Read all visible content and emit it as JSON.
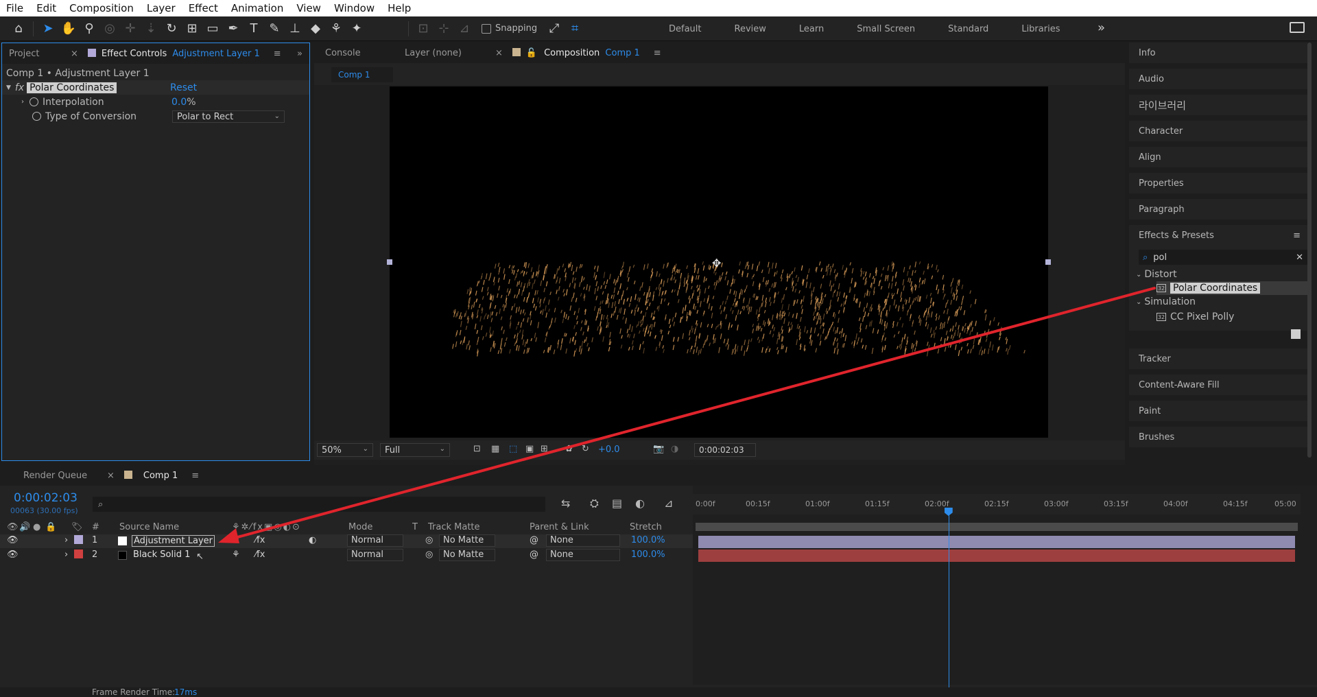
{
  "menu": [
    "File",
    "Edit",
    "Composition",
    "Layer",
    "Effect",
    "Animation",
    "View",
    "Window",
    "Help"
  ],
  "toolbar": {
    "snapping_label": "Snapping",
    "workspaces": [
      "Default",
      "Review",
      "Learn",
      "Small Screen",
      "Standard",
      "Libraries"
    ],
    "more_label": "»"
  },
  "left_panel": {
    "tabs": {
      "project": "Project",
      "close": "×",
      "effect_controls": "Effect Controls",
      "layer_ref": "Adjustment Layer 1",
      "menu": "≡",
      "expand": "»"
    },
    "breadcrumb": "Comp 1 • Adjustment Layer 1",
    "effect": {
      "fx_label": "fx",
      "name": "Polar Coordinates",
      "reset": "Reset",
      "interpolation_label": "Interpolation",
      "interpolation_value": "0.0",
      "interpolation_unit": "%",
      "conversion_label": "Type of Conversion",
      "conversion_value": "Polar to Rect"
    }
  },
  "comp_panel": {
    "tabs": {
      "console": "Console",
      "layer": "Layer (none)",
      "close": "×",
      "composition": "Composition",
      "comp_ref": "Comp 1",
      "menu": "≡"
    },
    "subtab": "Comp 1",
    "footer": {
      "zoom": "50%",
      "resolution": "Full",
      "exposure": "+0.0",
      "timecode": "0:00:02:03"
    }
  },
  "right_panel": {
    "items_top": [
      "Info",
      "Audio",
      "라이브러리",
      "Character",
      "Align",
      "Properties",
      "Paragraph"
    ],
    "effects_presets": {
      "title": "Effects & Presets",
      "menu": "≡",
      "search_value": "pol",
      "clear": "✕",
      "tree": [
        {
          "category": "Distort",
          "items": [
            "Polar Coordinates"
          ]
        },
        {
          "category": "Simulation",
          "items": [
            "CC Pixel Polly"
          ]
        }
      ]
    },
    "items_bottom": [
      "Tracker",
      "Content-Aware Fill",
      "Paint",
      "Brushes"
    ]
  },
  "timeline": {
    "tabs": {
      "render_queue": "Render Queue",
      "close": "×",
      "comp": "Comp 1",
      "menu": "≡"
    },
    "timecode": "0:00:02:03",
    "fps": "00063 (30.00 fps)",
    "search_icon": "⌕",
    "columns": {
      "num": "#",
      "source": "Source Name",
      "mode": "Mode",
      "t": "T",
      "track_matte": "Track Matte",
      "parent": "Parent & Link",
      "stretch": "Stretch"
    },
    "layers": [
      {
        "index": "1",
        "name": "Adjustment Layer",
        "mode": "Normal",
        "matte": "No Matte",
        "parent": "None",
        "stretch": "100.0%",
        "color": "#b3a9d9"
      },
      {
        "index": "2",
        "name": "Black Solid 1",
        "mode": "Normal",
        "matte": "No Matte",
        "parent": "None",
        "stretch": "100.0%",
        "color": "#d04040"
      }
    ],
    "ruler_ticks": [
      "0:00f",
      "00:15f",
      "01:00f",
      "01:15f",
      "02:00f",
      "02:15f",
      "03:00f",
      "03:15f",
      "04:00f",
      "04:15f",
      "05:00"
    ],
    "playhead_seconds": 2.1,
    "duration_seconds": 5
  },
  "status": {
    "label": "Frame Render Time:",
    "value": "17ms"
  },
  "colors": {
    "accent": "#2d8ceb",
    "annotation_arrow": "#e0242c"
  }
}
